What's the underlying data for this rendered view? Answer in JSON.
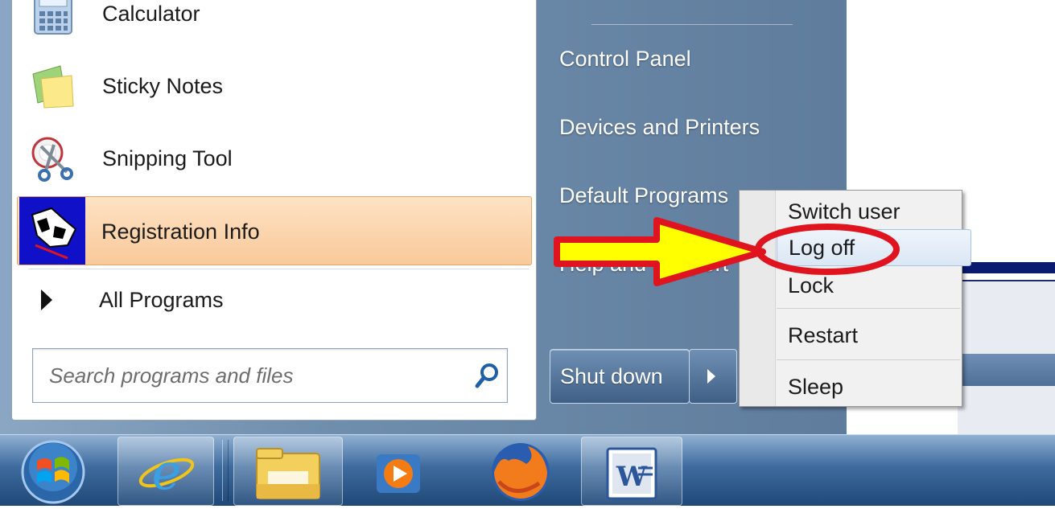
{
  "programs": [
    {
      "label": "Calculator",
      "icon": "calculator-icon"
    },
    {
      "label": "Sticky Notes",
      "icon": "sticky-notes-icon"
    },
    {
      "label": "Snipping Tool",
      "icon": "snipping-tool-icon"
    },
    {
      "label": "Registration Info",
      "icon": "registration-info-icon"
    }
  ],
  "all_programs_label": "All Programs",
  "search": {
    "placeholder": "Search programs and files"
  },
  "right_items": [
    "Control Panel",
    "Devices and Printers",
    "Default Programs",
    "Help and Support"
  ],
  "shutdown": {
    "label": "Shut down"
  },
  "submenu": {
    "items": [
      "Switch user",
      "Log off",
      "Lock",
      "Restart",
      "Sleep"
    ],
    "highlighted": "Log off"
  },
  "taskbar": {
    "items": [
      "start-orb-icon",
      "internet-explorer-icon",
      "windows-explorer-icon",
      "media-player-icon",
      "firefox-icon",
      "word-icon"
    ]
  },
  "colors": {
    "highlight": "#f9c99a",
    "annotation_arrow": "#ffff00",
    "annotation_outline": "#e0141e"
  }
}
